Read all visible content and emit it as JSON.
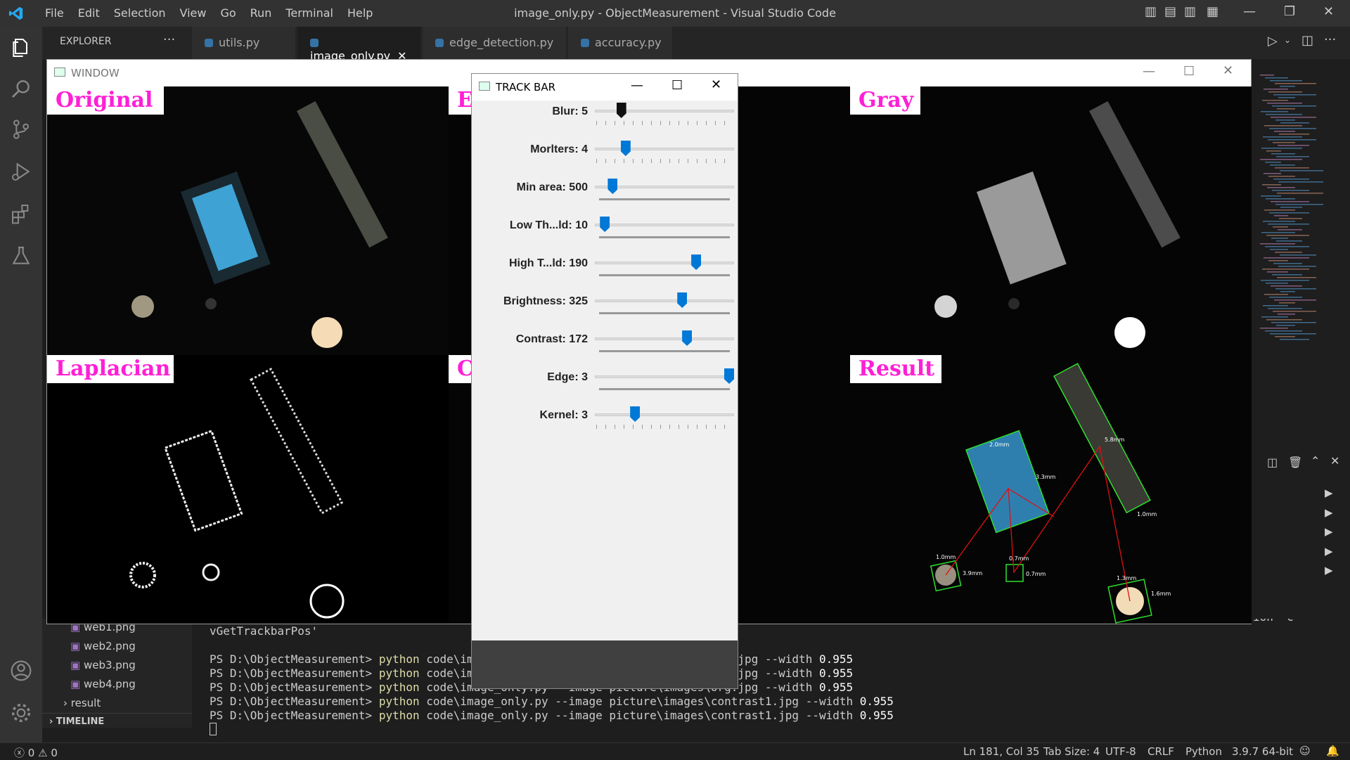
{
  "menu": [
    "File",
    "Edit",
    "Selection",
    "View",
    "Go",
    "Run",
    "Terminal",
    "Help"
  ],
  "window_title": "image_only.py - ObjectMeasurement - Visual Studio Code",
  "explorer_label": "EXPLORER",
  "tabs": [
    {
      "label": "utils.py"
    },
    {
      "label": "image_only.py"
    },
    {
      "label": "edge_detection.py"
    },
    {
      "label": "accuracy.py"
    }
  ],
  "cv_window": {
    "title": "WINDOW",
    "quads": [
      "Original",
      "E",
      "Gray",
      "Laplacian",
      "C",
      "Result"
    ]
  },
  "trackbar": {
    "title": "TRACK BAR",
    "sliders": [
      {
        "label": "Blur: 5",
        "value": 5,
        "max": 30
      },
      {
        "label": "Morlters: 4",
        "value": 4,
        "max": 20
      },
      {
        "label": "Min area: 500",
        "value": 500,
        "max": 5000
      },
      {
        "label": "Low Th...ld: 10",
        "value": 10,
        "max": 255
      },
      {
        "label": "High T...ld: 190",
        "value": 190,
        "max": 255
      },
      {
        "label": "Brightness: 325",
        "value": 325,
        "max": 510
      },
      {
        "label": "Contrast: 172",
        "value": 172,
        "max": 255
      },
      {
        "label": "Edge: 3",
        "value": 3,
        "max": 3
      },
      {
        "label": "Kernel: 3",
        "value": 3,
        "max": 11
      }
    ]
  },
  "sidebar_files": [
    "web1.png",
    "web2.png",
    "web3.png",
    "web4.png"
  ],
  "sidebar_folder": "result",
  "timeline_label": "TIMELINE",
  "terminal": {
    "top_fragment": "vGetTrackbarPos'",
    "right_fragment": "ion 'c",
    "lines": [
      {
        "prompt": "PS D:\\ObjectMeasurement>",
        "cmd": "python",
        "rest": " code\\image_only.py --image picture\\images\\org.jpg --width ",
        "val": "0.955"
      },
      {
        "prompt": "PS D:\\ObjectMeasurement>",
        "cmd": "python",
        "rest": " code\\image_only.py --image picture\\images\\org.jpg --width ",
        "val": "0.955"
      },
      {
        "prompt": "PS D:\\ObjectMeasurement>",
        "cmd": "python",
        "rest": " code\\image_only.py --image picture\\images\\org.jpg --width ",
        "val": "0.955"
      },
      {
        "prompt": "PS D:\\ObjectMeasurement>",
        "cmd": "python",
        "rest": " code\\image_only.py --image picture\\images\\contrast1.jpg --width ",
        "val": "0.955"
      },
      {
        "prompt": "PS D:\\ObjectMeasurement>",
        "cmd": "python",
        "rest": " code\\image_only.py --image picture\\images\\contrast1.jpg --width ",
        "val": "0.955"
      }
    ]
  },
  "status": {
    "errors": "0",
    "warnings": "0",
    "position": "Ln 181, Col 35",
    "tab_size": "Tab Size: 4",
    "encoding": "UTF-8",
    "eol": "CRLF",
    "language": "Python",
    "interpreter": "3.9.7 64-bit"
  },
  "result_labels": [
    "2.0mm",
    "3.3mm",
    "5.8mm",
    "1.0mm",
    "1.0mm",
    "3.9mm",
    "0.7mm",
    "0.7mm",
    "1.3mm",
    "1.6mm"
  ],
  "colors": {
    "accent": "#0078d7",
    "label_magenta": "#ff1fd6",
    "python_yellow": "#dcdcaa"
  }
}
